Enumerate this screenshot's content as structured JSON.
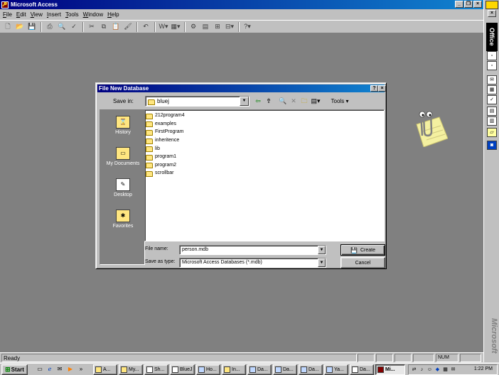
{
  "window": {
    "title": "Microsoft Access"
  },
  "menu": [
    {
      "label": "File",
      "u": "F",
      "rest": "ile"
    },
    {
      "label": "Edit",
      "u": "E",
      "rest": "dit"
    },
    {
      "label": "View",
      "u": "V",
      "rest": "iew"
    },
    {
      "label": "Insert",
      "u": "I",
      "rest": "nsert"
    },
    {
      "label": "Tools",
      "u": "T",
      "rest": "ools"
    },
    {
      "label": "Window",
      "u": "W",
      "rest": "indow"
    },
    {
      "label": "Help",
      "u": "H",
      "rest": "elp"
    }
  ],
  "dialog": {
    "title": "File New Database",
    "save_in_label": "Save in:",
    "save_in_value": "bluej",
    "tools_label": "Tools",
    "places": [
      "History",
      "My Documents",
      "Desktop",
      "Favorites"
    ],
    "files": [
      "212program4",
      "examples",
      "FirstProgram",
      "inheritence",
      "lib",
      "program1",
      "program2",
      "scrollbar"
    ],
    "file_name_label": "File name:",
    "file_name_value": "person.mdb",
    "save_as_type_label": "Save as type:",
    "save_as_type_value": "Microsoft Access Databases (*.mdb)",
    "create_label": "Create",
    "cancel_label": "Cancel"
  },
  "officebar": {
    "label": "Office",
    "brand": "Microsoft"
  },
  "status": {
    "text": "Ready",
    "num": "NUM"
  },
  "taskbar": {
    "start": "Start",
    "tasks": [
      "A...",
      "My...",
      "Sh...",
      "BlueJ",
      "Ho...",
      "In...",
      "Da...",
      "Da...",
      "Da...",
      "Ya...",
      "Da...",
      "Mi..."
    ],
    "clock": "1:22 PM"
  }
}
